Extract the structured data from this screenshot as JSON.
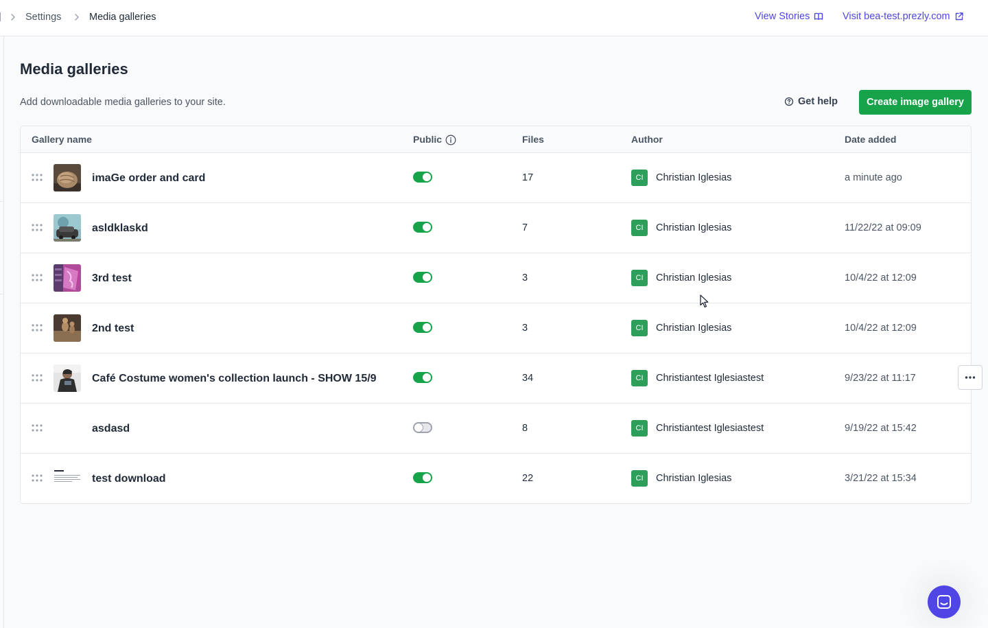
{
  "breadcrumb": {
    "items": [
      {
        "label": "Settings"
      },
      {
        "label": "Media galleries"
      }
    ]
  },
  "header_links": {
    "view_stories": "View Stories",
    "visit_site": "Visit bea-test.prezly.com"
  },
  "page": {
    "title": "Media galleries",
    "description": "Add downloadable media galleries to your site.",
    "get_help": "Get help",
    "create_button": "Create image gallery"
  },
  "table": {
    "columns": {
      "name": "Gallery name",
      "public": "Public",
      "files": "Files",
      "author": "Author",
      "date": "Date added"
    },
    "rows": [
      {
        "name": "imaGe order and card",
        "public": true,
        "files": "17",
        "avatar": "CI",
        "author": "Christian Iglesias",
        "date": "a minute ago",
        "thumb": "bread"
      },
      {
        "name": "asldklaskd",
        "public": true,
        "files": "7",
        "avatar": "CI",
        "author": "Christian Iglesias",
        "date": "11/22/22 at 09:09",
        "thumb": "car"
      },
      {
        "name": "3rd test",
        "public": true,
        "files": "3",
        "avatar": "CI",
        "author": "Christian Iglesias",
        "date": "10/4/22 at 12:09",
        "thumb": "pink"
      },
      {
        "name": "2nd test",
        "public": true,
        "files": "3",
        "avatar": "CI",
        "author": "Christian Iglesias",
        "date": "10/4/22 at 12:09",
        "thumb": "meerkat"
      },
      {
        "name": "Café Costume women's collection launch - SHOW 15/9",
        "public": true,
        "files": "34",
        "avatar": "CI",
        "author": "Christiantest Iglesiastest",
        "date": "9/23/22 at 11:17",
        "thumb": "person"
      },
      {
        "name": "asdasd",
        "public": false,
        "files": "8",
        "avatar": "CI",
        "author": "Christiantest Iglesiastest",
        "date": "9/19/22 at 15:42",
        "thumb": "none"
      },
      {
        "name": "test download",
        "public": true,
        "files": "22",
        "avatar": "CI",
        "author": "Christian Iglesias",
        "date": "3/21/22 at 15:34",
        "thumb": "document"
      }
    ]
  },
  "colors": {
    "accent_green": "#16a34a",
    "link_indigo": "#4f46e5",
    "avatar_green": "#2e9e5b"
  },
  "icons": {
    "breadcrumb_separator": "chevron-right-icon",
    "view_stories": "book-open-icon",
    "visit_site": "external-link-icon",
    "get_help": "question-circle-icon",
    "public_info": "info-icon",
    "drag": "drag-handle-icon",
    "row_menu": "more-horizontal-icon",
    "chat": "chat-icon"
  }
}
